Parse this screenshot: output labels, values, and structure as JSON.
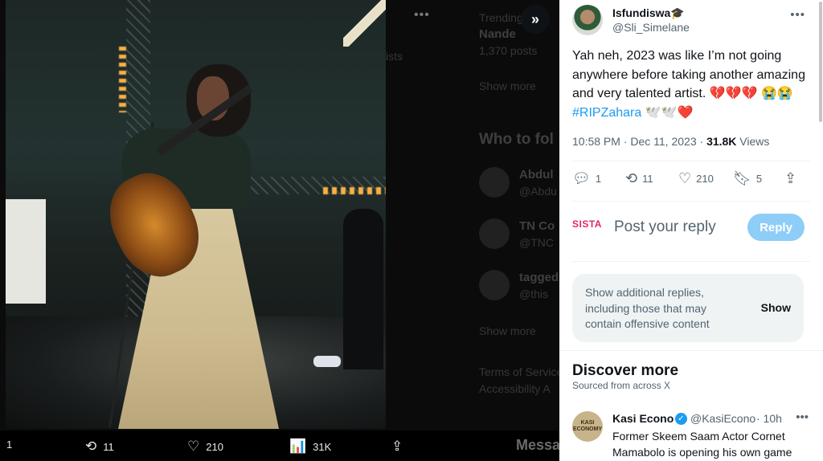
{
  "background": {
    "ghost": {
      "trending_label": "Trending",
      "trend_name": "Nande",
      "trend_posts": "1,370 posts",
      "lists_fragment": "ists",
      "show_more": "Show more",
      "who_to_follow": "Who to fol",
      "follow_1_name": "Abdul",
      "follow_1_handle": "@Abdu",
      "follow_2_name": "TN Co",
      "follow_2_handle": "@TNC",
      "follow_3_name": "tagged",
      "follow_3_handle": "@this",
      "show_more_2": "Show more",
      "terms": "Terms of Service",
      "accessibility": "Accessibility   A",
      "messages": "Messa"
    }
  },
  "viewer": {
    "collapse_icon": "chevron-double-right-icon",
    "media_bar": {
      "replies": "1",
      "reposts": "11",
      "likes": "210",
      "views": "31K"
    }
  },
  "tweet": {
    "author_name": "Isfundiswa🎓",
    "author_handle": "@Sli_Simelane",
    "text_before": "Yah neh, 2023 was like I’m not going anywhere before taking another amazing and very talented artist. 💔💔💔 😭😭 ",
    "hashtag": "#RIPZahara",
    "text_after": " 🕊️🕊️❤️",
    "time": "10:58 PM · Dec 11, 2023 · ",
    "views_count": "31.8K",
    "views_label": " Views",
    "actions": {
      "replies": "1",
      "reposts": "11",
      "likes": "210",
      "bookmarks": "5"
    }
  },
  "reply_box": {
    "avatar_text": "SISTA",
    "placeholder": "Post your reply",
    "button": "Reply"
  },
  "hidden_replies": {
    "text": "Show additional replies, including those that may contain offensive content",
    "button": "Show"
  },
  "discover": {
    "title": "Discover more",
    "subtitle": "Sourced from across X",
    "post": {
      "avatar_text": "KASI ECONOMY",
      "name": "Kasi Econo",
      "handle": "@KasiEcono",
      "time": "· 10h",
      "text": "Former Skeem Saam Actor Cornet Mamabolo is opening his own game"
    }
  },
  "colors": {
    "accent": "#1d9bf0",
    "reply_button_disabled": "#8ecdf8",
    "secondary_text": "#536471"
  }
}
